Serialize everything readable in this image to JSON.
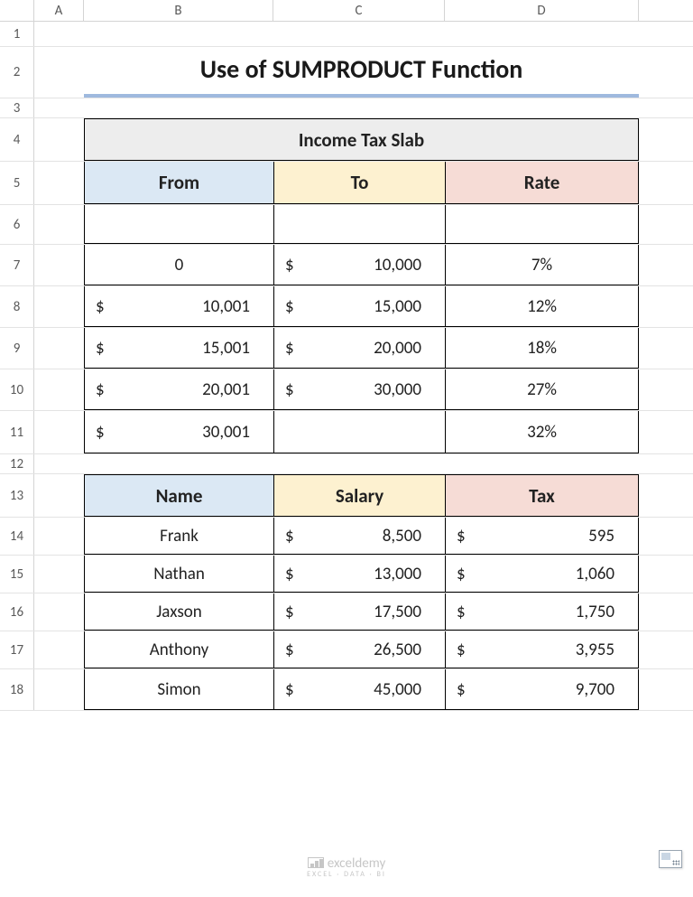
{
  "columns": [
    "A",
    "B",
    "C",
    "D"
  ],
  "row_numbers": [
    1,
    2,
    3,
    4,
    5,
    6,
    7,
    8,
    9,
    10,
    11,
    12,
    13,
    14,
    15,
    16,
    17,
    18
  ],
  "title": "Use of SUMPRODUCT Function",
  "tax_slab": {
    "heading": "Income Tax Slab",
    "headers": {
      "from": "From",
      "to": "To",
      "rate": "Rate"
    },
    "rows": [
      {
        "from": "",
        "to": "",
        "rate": ""
      },
      {
        "from": "0",
        "to": "$  10,000",
        "rate": "7%"
      },
      {
        "from": "$  10,001",
        "to": "$  15,000",
        "rate": "12%"
      },
      {
        "from": "$  15,001",
        "to": "$  20,000",
        "rate": "18%"
      },
      {
        "from": "$  20,001",
        "to": "$  30,000",
        "rate": "27%"
      },
      {
        "from": "$  30,001",
        "to": "",
        "rate": "32%"
      }
    ]
  },
  "people": {
    "headers": {
      "name": "Name",
      "salary": "Salary",
      "tax": "Tax"
    },
    "rows": [
      {
        "name": "Frank",
        "salary": "$   8,500",
        "tax": "$        595"
      },
      {
        "name": "Nathan",
        "salary": "$  13,000",
        "tax": "$     1,060"
      },
      {
        "name": "Jaxson",
        "salary": "$  17,500",
        "tax": "$     1,750"
      },
      {
        "name": "Anthony",
        "salary": "$  26,500",
        "tax": "$     3,955"
      },
      {
        "name": "Simon",
        "salary": "$  45,000",
        "tax": "$     9,700"
      }
    ]
  },
  "watermark": {
    "brand": "exceldemy",
    "tagline": "EXCEL · DATA · BI"
  },
  "chart_data": {
    "type": "table",
    "tables": [
      {
        "title": "Income Tax Slab",
        "columns": [
          "From",
          "To",
          "Rate"
        ],
        "rows": [
          [
            0,
            10000,
            0.07
          ],
          [
            10001,
            15000,
            0.12
          ],
          [
            15001,
            20000,
            0.18
          ],
          [
            20001,
            30000,
            0.27
          ],
          [
            30001,
            null,
            0.32
          ]
        ]
      },
      {
        "title": "Salary and Tax",
        "columns": [
          "Name",
          "Salary",
          "Tax"
        ],
        "rows": [
          [
            "Frank",
            8500,
            595
          ],
          [
            "Nathan",
            13000,
            1060
          ],
          [
            "Jaxson",
            17500,
            1750
          ],
          [
            "Anthony",
            26500,
            3955
          ],
          [
            "Simon",
            45000,
            9700
          ]
        ]
      }
    ]
  }
}
